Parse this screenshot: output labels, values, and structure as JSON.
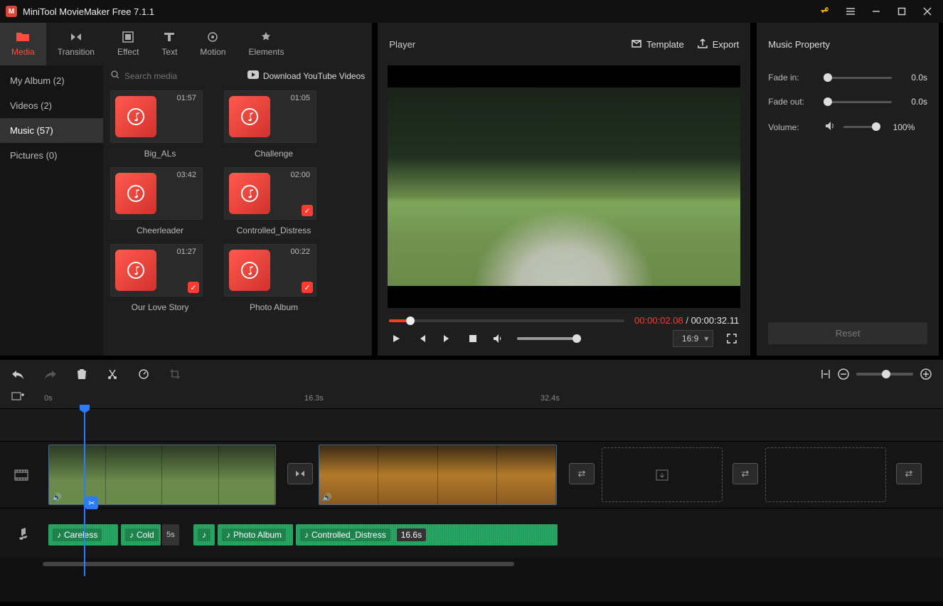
{
  "app": {
    "title": "MiniTool MovieMaker Free 7.1.1"
  },
  "tabs": {
    "media": "Media",
    "transition": "Transition",
    "effect": "Effect",
    "text": "Text",
    "motion": "Motion",
    "elements": "Elements"
  },
  "library": {
    "search_placeholder": "Search media",
    "yt_link": "Download YouTube Videos",
    "categories": {
      "my_album": "My Album (2)",
      "videos": "Videos (2)",
      "music": "Music (57)",
      "pictures": "Pictures (0)"
    },
    "items": [
      {
        "name": "Big_ALs",
        "duration": "01:57",
        "checked": false
      },
      {
        "name": "Challenge",
        "duration": "01:05",
        "checked": false
      },
      {
        "name": "Cheerleader",
        "duration": "03:42",
        "checked": false
      },
      {
        "name": "Controlled_Distress",
        "duration": "02:00",
        "checked": true
      },
      {
        "name": "Our Love Story",
        "duration": "01:27",
        "checked": true
      },
      {
        "name": "Photo Album",
        "duration": "00:22",
        "checked": true
      }
    ]
  },
  "player": {
    "title": "Player",
    "template": "Template",
    "export": "Export",
    "current": "00:00:02.08",
    "separator": " / ",
    "total": "00:00:32.11",
    "aspect": "16:9"
  },
  "props": {
    "title": "Music Property",
    "fade_in_label": "Fade in:",
    "fade_in_value": "0.0s",
    "fade_out_label": "Fade out:",
    "fade_out_value": "0.0s",
    "volume_label": "Volume:",
    "volume_value": "100%",
    "reset": "Reset"
  },
  "ruler": {
    "m0": "0s",
    "m1": "16.3s",
    "m2": "32.4s"
  },
  "audio_clips": {
    "a0": "Careless",
    "a1": "Cold",
    "a1_dur": "5s",
    "a2": "",
    "a3": "Photo Album",
    "a4": "Controlled_Distress",
    "a4_dur": "16.6s"
  }
}
